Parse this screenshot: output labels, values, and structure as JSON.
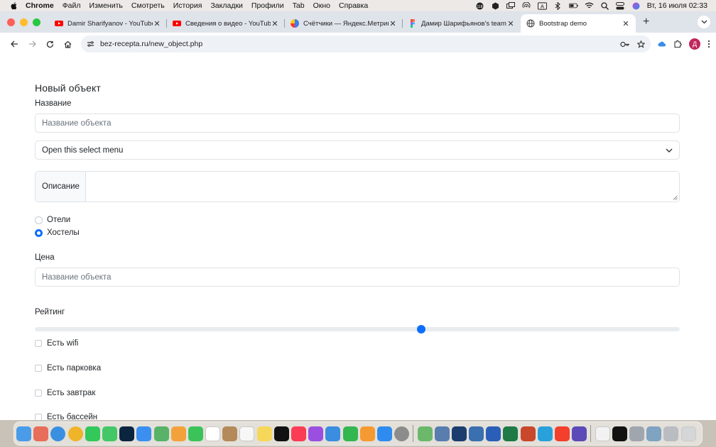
{
  "menubar": {
    "app": "Chrome",
    "items": [
      "Файл",
      "Изменить",
      "Смотреть",
      "История",
      "Закладки",
      "Профили",
      "Tab",
      "Окно",
      "Справка"
    ],
    "clock": "Вт, 16 июля  02:33",
    "status_icons": [
      "music-badge-icon",
      "shield-icon",
      "window-icon",
      "airdrop-icon",
      "input-a-icon",
      "bluetooth-icon",
      "battery-icon",
      "wifi-icon",
      "spotlight-icon",
      "control-center-icon",
      "siri-icon"
    ]
  },
  "browser": {
    "tabs": [
      {
        "title": "Damir Sharifyanov - YouTube",
        "icon": "youtube-icon",
        "active": false
      },
      {
        "title": "Сведения о видео - YouTube",
        "icon": "youtube-icon",
        "active": false
      },
      {
        "title": "Счётчики — Яндекс.Метрика",
        "icon": "yandex-metrika-icon",
        "active": false
      },
      {
        "title": "Дамир Шарифьянов's team lib",
        "icon": "figma-icon",
        "active": false
      },
      {
        "title": "Bootstrap demo",
        "icon": "globe-icon",
        "active": true
      }
    ],
    "url": "bez-recepta.ru/new_object.php",
    "profile_initial": "Д"
  },
  "form": {
    "title": "Новый объект",
    "name_label": "Название",
    "name_placeholder": "Название объекта",
    "select_value": "Open this select menu",
    "description_label": "Описание",
    "radios": [
      {
        "label": "Отели",
        "checked": false
      },
      {
        "label": "Хостелы",
        "checked": true
      }
    ],
    "price_label": "Цена",
    "price_placeholder": "Название объекта",
    "rating_label": "Рейтинг",
    "rating_value_fraction": 0.6,
    "checkboxes": [
      {
        "label": "Есть wifi",
        "checked": false
      },
      {
        "label": "Есть парковка",
        "checked": false
      },
      {
        "label": "Есть завтрак",
        "checked": false
      },
      {
        "label": "Есть бассейн",
        "checked": false
      }
    ]
  },
  "colors": {
    "accent": "#0d6efd",
    "border": "#dee2e6",
    "text": "#212529",
    "placeholder": "#6c757d"
  },
  "dock": {
    "apps": [
      "finder",
      "launchpad",
      "safari",
      "chrome",
      "whatsapp",
      "messages",
      "photoshop",
      "mail",
      "maps",
      "photos",
      "facetime",
      "calendar",
      "contacts-notes",
      "reminders",
      "notes",
      "apple-tv",
      "music",
      "podcasts",
      "keynote",
      "numbers",
      "pages",
      "app-store",
      "system-settings",
      "|",
      "maps-2",
      "preview",
      "mindmap",
      "monitor",
      "word",
      "excel",
      "powerpoint",
      "telegram",
      "yandex",
      "imovie",
      "|",
      "document",
      "terminal",
      "screenshot-1",
      "screenshot-2",
      "screenshot-3",
      "trash"
    ]
  }
}
